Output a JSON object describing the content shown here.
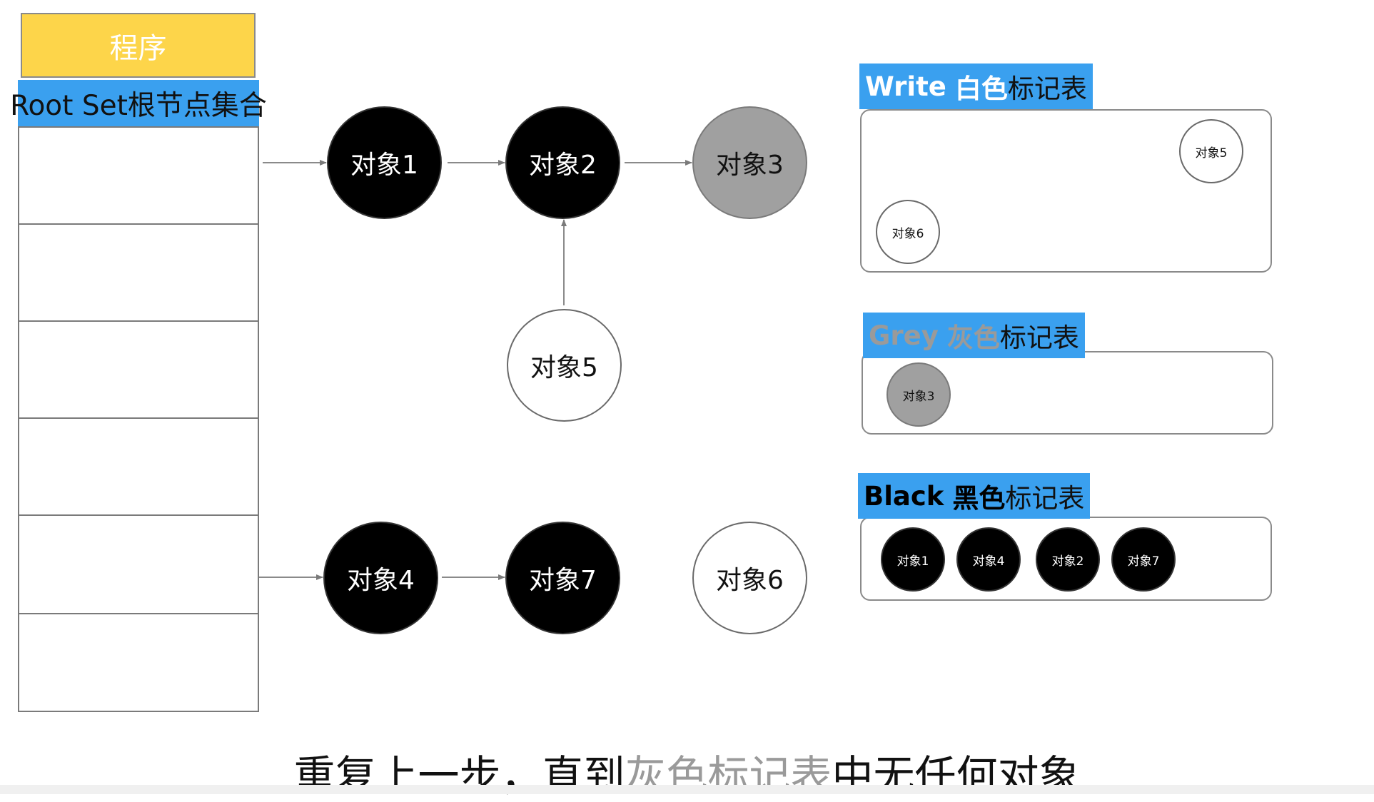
{
  "program": {
    "label": "程序"
  },
  "root_set": {
    "label": "Root Set根节点集合",
    "row_count": 6
  },
  "nodes": {
    "obj1": {
      "label": "对象1",
      "color": "black"
    },
    "obj2": {
      "label": "对象2",
      "color": "black"
    },
    "obj3": {
      "label": "对象3",
      "color": "grey"
    },
    "obj5": {
      "label": "对象5",
      "color": "white"
    },
    "obj4": {
      "label": "对象4",
      "color": "black"
    },
    "obj7": {
      "label": "对象7",
      "color": "black"
    },
    "obj6": {
      "label": "对象6",
      "color": "white"
    }
  },
  "tables": {
    "white": {
      "label_en": "Write",
      "label_color": "白色",
      "label_rest": "标记表",
      "items": [
        "对象5",
        "对象6"
      ]
    },
    "grey": {
      "label_en": "Grey",
      "label_color": "灰色",
      "label_rest": "标记表",
      "items": [
        "对象3"
      ]
    },
    "black": {
      "label_en": "Black",
      "label_color": "黑色",
      "label_rest": "标记表",
      "items": [
        "对象1",
        "对象4",
        "对象2",
        "对象7"
      ]
    }
  },
  "caption": {
    "part1": "重复上一步，直到",
    "highlight": "灰色标记表",
    "part2": "中无任何对象"
  },
  "colors": {
    "program_yellow": "#fdd54a",
    "header_blue": "#3aa0ef",
    "grey_node": "#a0a0a0",
    "highlight_grey": "#9a9a9a"
  }
}
